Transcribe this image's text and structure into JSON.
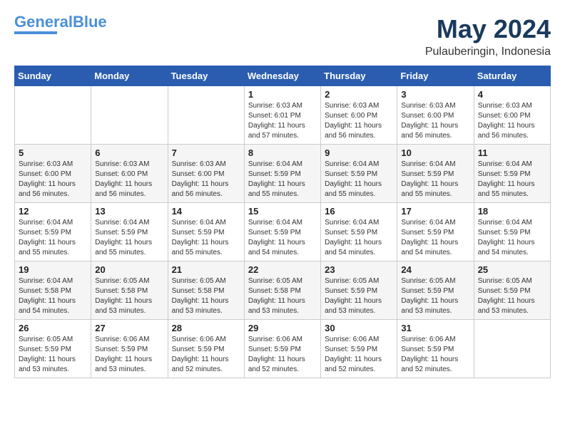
{
  "header": {
    "logo_line1": "General",
    "logo_line2": "Blue",
    "month": "May 2024",
    "location": "Pulauberingin, Indonesia"
  },
  "weekdays": [
    "Sunday",
    "Monday",
    "Tuesday",
    "Wednesday",
    "Thursday",
    "Friday",
    "Saturday"
  ],
  "weeks": [
    [
      {
        "day": "",
        "info": ""
      },
      {
        "day": "",
        "info": ""
      },
      {
        "day": "",
        "info": ""
      },
      {
        "day": "1",
        "info": "Sunrise: 6:03 AM\nSunset: 6:01 PM\nDaylight: 11 hours\nand 57 minutes."
      },
      {
        "day": "2",
        "info": "Sunrise: 6:03 AM\nSunset: 6:00 PM\nDaylight: 11 hours\nand 56 minutes."
      },
      {
        "day": "3",
        "info": "Sunrise: 6:03 AM\nSunset: 6:00 PM\nDaylight: 11 hours\nand 56 minutes."
      },
      {
        "day": "4",
        "info": "Sunrise: 6:03 AM\nSunset: 6:00 PM\nDaylight: 11 hours\nand 56 minutes."
      }
    ],
    [
      {
        "day": "5",
        "info": "Sunrise: 6:03 AM\nSunset: 6:00 PM\nDaylight: 11 hours\nand 56 minutes."
      },
      {
        "day": "6",
        "info": "Sunrise: 6:03 AM\nSunset: 6:00 PM\nDaylight: 11 hours\nand 56 minutes."
      },
      {
        "day": "7",
        "info": "Sunrise: 6:03 AM\nSunset: 6:00 PM\nDaylight: 11 hours\nand 56 minutes."
      },
      {
        "day": "8",
        "info": "Sunrise: 6:04 AM\nSunset: 5:59 PM\nDaylight: 11 hours\nand 55 minutes."
      },
      {
        "day": "9",
        "info": "Sunrise: 6:04 AM\nSunset: 5:59 PM\nDaylight: 11 hours\nand 55 minutes."
      },
      {
        "day": "10",
        "info": "Sunrise: 6:04 AM\nSunset: 5:59 PM\nDaylight: 11 hours\nand 55 minutes."
      },
      {
        "day": "11",
        "info": "Sunrise: 6:04 AM\nSunset: 5:59 PM\nDaylight: 11 hours\nand 55 minutes."
      }
    ],
    [
      {
        "day": "12",
        "info": "Sunrise: 6:04 AM\nSunset: 5:59 PM\nDaylight: 11 hours\nand 55 minutes."
      },
      {
        "day": "13",
        "info": "Sunrise: 6:04 AM\nSunset: 5:59 PM\nDaylight: 11 hours\nand 55 minutes."
      },
      {
        "day": "14",
        "info": "Sunrise: 6:04 AM\nSunset: 5:59 PM\nDaylight: 11 hours\nand 55 minutes."
      },
      {
        "day": "15",
        "info": "Sunrise: 6:04 AM\nSunset: 5:59 PM\nDaylight: 11 hours\nand 54 minutes."
      },
      {
        "day": "16",
        "info": "Sunrise: 6:04 AM\nSunset: 5:59 PM\nDaylight: 11 hours\nand 54 minutes."
      },
      {
        "day": "17",
        "info": "Sunrise: 6:04 AM\nSunset: 5:59 PM\nDaylight: 11 hours\nand 54 minutes."
      },
      {
        "day": "18",
        "info": "Sunrise: 6:04 AM\nSunset: 5:59 PM\nDaylight: 11 hours\nand 54 minutes."
      }
    ],
    [
      {
        "day": "19",
        "info": "Sunrise: 6:04 AM\nSunset: 5:58 PM\nDaylight: 11 hours\nand 54 minutes."
      },
      {
        "day": "20",
        "info": "Sunrise: 6:05 AM\nSunset: 5:58 PM\nDaylight: 11 hours\nand 53 minutes."
      },
      {
        "day": "21",
        "info": "Sunrise: 6:05 AM\nSunset: 5:58 PM\nDaylight: 11 hours\nand 53 minutes."
      },
      {
        "day": "22",
        "info": "Sunrise: 6:05 AM\nSunset: 5:58 PM\nDaylight: 11 hours\nand 53 minutes."
      },
      {
        "day": "23",
        "info": "Sunrise: 6:05 AM\nSunset: 5:59 PM\nDaylight: 11 hours\nand 53 minutes."
      },
      {
        "day": "24",
        "info": "Sunrise: 6:05 AM\nSunset: 5:59 PM\nDaylight: 11 hours\nand 53 minutes."
      },
      {
        "day": "25",
        "info": "Sunrise: 6:05 AM\nSunset: 5:59 PM\nDaylight: 11 hours\nand 53 minutes."
      }
    ],
    [
      {
        "day": "26",
        "info": "Sunrise: 6:05 AM\nSunset: 5:59 PM\nDaylight: 11 hours\nand 53 minutes."
      },
      {
        "day": "27",
        "info": "Sunrise: 6:06 AM\nSunset: 5:59 PM\nDaylight: 11 hours\nand 53 minutes."
      },
      {
        "day": "28",
        "info": "Sunrise: 6:06 AM\nSunset: 5:59 PM\nDaylight: 11 hours\nand 52 minutes."
      },
      {
        "day": "29",
        "info": "Sunrise: 6:06 AM\nSunset: 5:59 PM\nDaylight: 11 hours\nand 52 minutes."
      },
      {
        "day": "30",
        "info": "Sunrise: 6:06 AM\nSunset: 5:59 PM\nDaylight: 11 hours\nand 52 minutes."
      },
      {
        "day": "31",
        "info": "Sunrise: 6:06 AM\nSunset: 5:59 PM\nDaylight: 11 hours\nand 52 minutes."
      },
      {
        "day": "",
        "info": ""
      }
    ]
  ]
}
